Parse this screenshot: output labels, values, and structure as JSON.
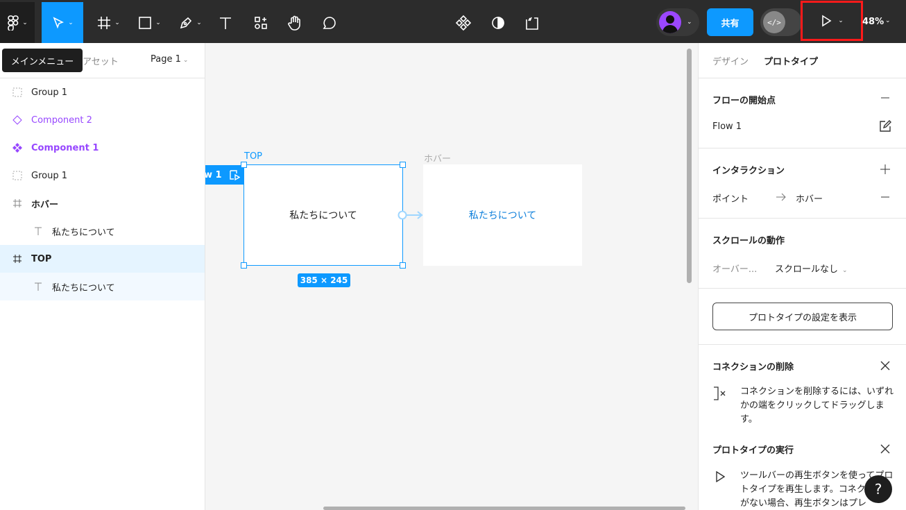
{
  "toolbar": {
    "main_menu_tooltip": "メインメニュー",
    "share_label": "共有",
    "dev_mode_label": "</>",
    "zoom": "48%"
  },
  "left_panel": {
    "assets_tab": "アセット",
    "page_label": "Page 1",
    "layers": [
      {
        "label": "Group 1",
        "icon": "dashed-frame-icon"
      },
      {
        "label": "Component 2",
        "icon": "component-instance-icon"
      },
      {
        "label": "Component 1",
        "icon": "main-component-icon"
      },
      {
        "label": "Group 1",
        "icon": "dashed-frame-icon"
      },
      {
        "label": "ホバー",
        "icon": "frame-icon"
      },
      {
        "label": "私たちについて",
        "icon": "text-icon"
      },
      {
        "label": "TOP",
        "icon": "frame-icon"
      },
      {
        "label": "私たちについて",
        "icon": "text-icon"
      }
    ]
  },
  "canvas": {
    "frame_top_label": "TOP",
    "frame_top_text": "私たちについて",
    "frame_hover_label": "ホバー",
    "frame_hover_text": "私たちについて",
    "size_badge": "385 × 245",
    "flow_badge": "w 1"
  },
  "right_panel": {
    "tab_design": "デザイン",
    "tab_prototype": "プロトタイプ",
    "flow_start_title": "フローの開始点",
    "flow_name": "Flow 1",
    "interaction_title": "インタラクション",
    "interaction_trigger": "ポイント",
    "interaction_target": "ホバー",
    "scroll_title": "スクロールの動作",
    "scroll_overflow_label": "オーバー...",
    "scroll_value": "スクロールなし",
    "show_settings_button": "プロトタイプの設定を表示",
    "delete_connection_title": "コネクションの削除",
    "delete_connection_text": "コネクションを削除するには、いずれかの端をクリックしてドラッグします。",
    "run_prototype_title": "プロトタイプの実行",
    "run_prototype_text": "ツールバーの再生ボタンを使ってプロトタイプを再生します。コネクションがない場合、再生ボタンはプレ"
  },
  "colors": {
    "accent": "#0d99ff",
    "component": "#9747ff",
    "toolbar_bg": "#2c2c2c",
    "highlight_border": "#ff1a1a"
  }
}
